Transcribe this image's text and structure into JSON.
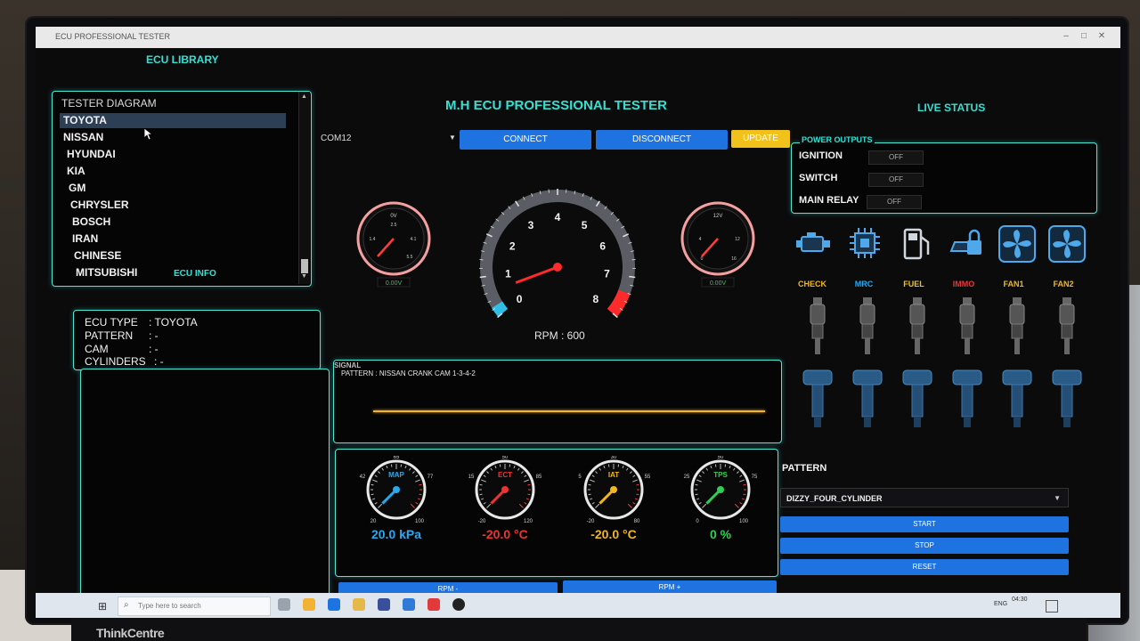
{
  "window": {
    "title": "ECU PROFESSIONAL TESTER",
    "min": "–",
    "max": "□",
    "close": "✕"
  },
  "library": {
    "header": "ECU LIBRARY",
    "title": "TESTER DIAGRAM",
    "items": [
      "TOYOTA",
      "NISSAN",
      "HYUNDAI",
      "KIA",
      "GM",
      "CHRYSLER",
      "BOSCH",
      "IRAN",
      "CHINESE",
      "MITSUBISHI"
    ],
    "selected": "TOYOTA"
  },
  "ecu_info": {
    "header": "ECU INFO",
    "lines": [
      {
        "label": "ECU TYPE",
        "value": ": TOYOTA"
      },
      {
        "label": "PATTERN",
        "value": ": -"
      },
      {
        "label": "CAM",
        "value": ": -"
      },
      {
        "label": "CYLINDERS",
        "value": ": -"
      }
    ]
  },
  "main": {
    "title": "M.H ECU PROFESSIONAL TESTER",
    "com_port": "COM12",
    "connect": "CONNECT",
    "disconnect": "DISCONNECT",
    "update": "UPDATE",
    "rpm_text": "RPM : 600",
    "rpm_gauge": {
      "min": 0,
      "max": 8,
      "ticks": [
        "0",
        "1",
        "2",
        "3",
        "4",
        "5",
        "6",
        "7",
        "8"
      ],
      "value": 0.6
    },
    "left_gauge": {
      "ticks": [
        "0V",
        "2.5",
        "1.4",
        "4.1",
        "5.5"
      ],
      "readout": "0.00V"
    },
    "right_gauge": {
      "ticks": [
        "12V",
        "4",
        "12",
        "0",
        "16"
      ],
      "readout": "0.00V"
    },
    "signal_label": "SIGNAL",
    "signal_pattern": "PATTERN : NISSAN CRANK CAM 1-3-4-2",
    "rpm_minus": "RPM -",
    "rpm_plus": "RPM +"
  },
  "sensors": [
    {
      "name": "MAP",
      "value": "20.0 kPa",
      "color": "#2aa8ee",
      "ticks": [
        "65",
        "42",
        "77",
        "20",
        "100"
      ]
    },
    {
      "name": "ECT",
      "value": "-20.0 °C",
      "color": "#ee3333",
      "ticks": [
        "50",
        "15",
        "85",
        "-20",
        "120"
      ]
    },
    {
      "name": "IAT",
      "value": "-20.0 °C",
      "color": "#f2b71d",
      "ticks": [
        "30",
        "5",
        "55",
        "-20",
        "80"
      ]
    },
    {
      "name": "TPS",
      "value": "0 %",
      "color": "#2fcf55",
      "ticks": [
        "50",
        "25",
        "75",
        "0",
        "100"
      ]
    }
  ],
  "status": {
    "header": "LIVE STATUS",
    "power_title": "POWER OUTPUTS",
    "outputs": [
      {
        "label": "IGNITION",
        "state": "OFF"
      },
      {
        "label": "SWITCH",
        "state": "OFF"
      },
      {
        "label": "MAIN RELAY",
        "state": "OFF"
      }
    ],
    "indicators": [
      {
        "label": "CHECK",
        "color": "#f2b71d",
        "icon": "engine-icon"
      },
      {
        "label": "MRC",
        "color": "#2aa8ee",
        "icon": "chip-icon"
      },
      {
        "label": "FUEL",
        "color": "#f2c21c",
        "icon": "fuel-pump-icon"
      },
      {
        "label": "IMMO",
        "color": "#e23a3a",
        "icon": "car-lock-icon"
      },
      {
        "label": "FAN1",
        "color": "#f2b71d",
        "icon": "fan-icon"
      },
      {
        "label": "FAN2",
        "color": "#f2b71d",
        "icon": "fan-icon"
      }
    ]
  },
  "pattern": {
    "label": "PATTERN",
    "selected": "DIZZY_FOUR_CYLINDER",
    "start": "START",
    "stop": "STOP",
    "reset": "RESET"
  },
  "taskbar": {
    "search_placeholder": "Type here to search",
    "language": "ENG",
    "clock": "04:30"
  },
  "monitor_brand": "ThinkCentre"
}
